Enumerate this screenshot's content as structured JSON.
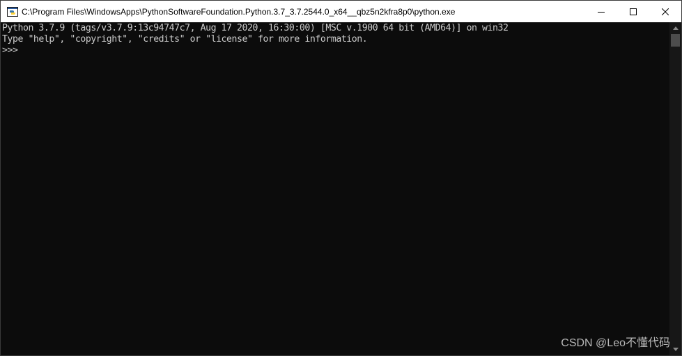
{
  "window": {
    "title": "C:\\Program Files\\WindowsApps\\PythonSoftwareFoundation.Python.3.7_3.7.2544.0_x64__qbz5n2kfra8p0\\python.exe",
    "icon": "python-icon"
  },
  "controls": {
    "minimize": "minimize-icon",
    "maximize": "maximize-icon",
    "close": "close-icon"
  },
  "console": {
    "lines": [
      "Python 3.7.9 (tags/v3.7.9:13c94747c7, Aug 17 2020, 16:30:00) [MSC v.1900 64 bit (AMD64)] on win32",
      "Type \"help\", \"copyright\", \"credits\" or \"license\" for more information.",
      ">>>"
    ]
  },
  "watermark": "CSDN @Leo不懂代码",
  "colors": {
    "background": "#0c0c0c",
    "text": "#cccccc",
    "titlebar": "#ffffff"
  }
}
